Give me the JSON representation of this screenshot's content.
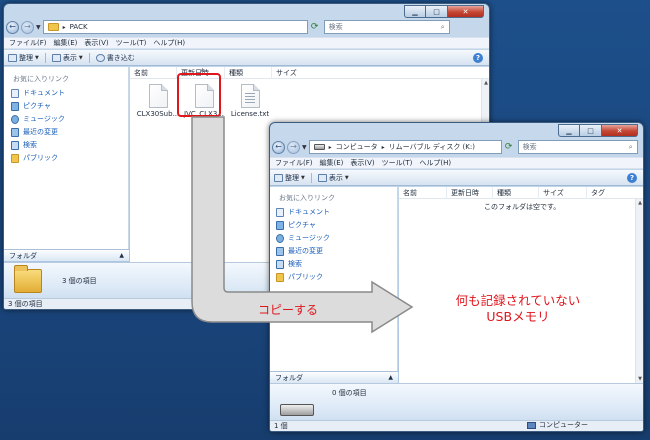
{
  "window1": {
    "address": "PACK",
    "search_placeholder": "検索",
    "menu": [
      "ファイル(F)",
      "編集(E)",
      "表示(V)",
      "ツール(T)",
      "ヘルプ(H)"
    ],
    "toolbar": {
      "organize": "整理",
      "views": "表示",
      "burn": "書き込む"
    },
    "nav_heading": "お気に入りリンク",
    "nav_items": [
      {
        "label": "ドキュメント",
        "icon": "documents-icon"
      },
      {
        "label": "ピクチャ",
        "icon": "pictures-icon"
      },
      {
        "label": "ミュージック",
        "icon": "music-icon"
      },
      {
        "label": "最近の変更",
        "icon": "recent-icon"
      },
      {
        "label": "検索",
        "icon": "search-icon"
      },
      {
        "label": "パブリック",
        "icon": "public-icon"
      }
    ],
    "folders_label": "フォルダ",
    "columns": [
      "名前",
      "更新日時",
      "種類",
      "サイズ"
    ],
    "files": [
      {
        "name": "CLX30Sub...",
        "icon": "blank-file-icon"
      },
      {
        "name": "JVC_CLX3...",
        "icon": "blank-file-icon"
      },
      {
        "name": "License.txt",
        "icon": "text-file-icon"
      }
    ],
    "details_text": "3 個の項目",
    "status_text": "3 個の項目"
  },
  "window2": {
    "address": [
      "コンピュータ",
      "リムーバブル ディスク (K:)"
    ],
    "search_placeholder": "検索",
    "menu": [
      "ファイル(F)",
      "編集(E)",
      "表示(V)",
      "ツール(T)",
      "ヘルプ(H)"
    ],
    "toolbar": {
      "organize": "整理",
      "views": "表示"
    },
    "nav_heading": "お気に入りリンク",
    "nav_items": [
      {
        "label": "ドキュメント",
        "icon": "documents-icon"
      },
      {
        "label": "ピクチャ",
        "icon": "pictures-icon"
      },
      {
        "label": "ミュージック",
        "icon": "music-icon"
      },
      {
        "label": "最近の変更",
        "icon": "recent-icon"
      },
      {
        "label": "検索",
        "icon": "search-icon"
      },
      {
        "label": "パブリック",
        "icon": "public-icon"
      }
    ],
    "folders_label": "フォルダ",
    "columns": [
      "名前",
      "更新日時",
      "種類",
      "サイズ",
      "タグ"
    ],
    "empty_message": "このフォルダは空です。",
    "details_text": "0 個の項目",
    "status_text": "1 個",
    "status_right": "コンピューター"
  },
  "annotations": {
    "copy_label": "コピーする",
    "note_line1": "何も記録されていない",
    "note_line2": "USBメモリ"
  },
  "colors": {
    "annotation_red": "#e0161d",
    "arrow_fill": "#dcdcdc",
    "desktop": "#1d4f8a"
  }
}
